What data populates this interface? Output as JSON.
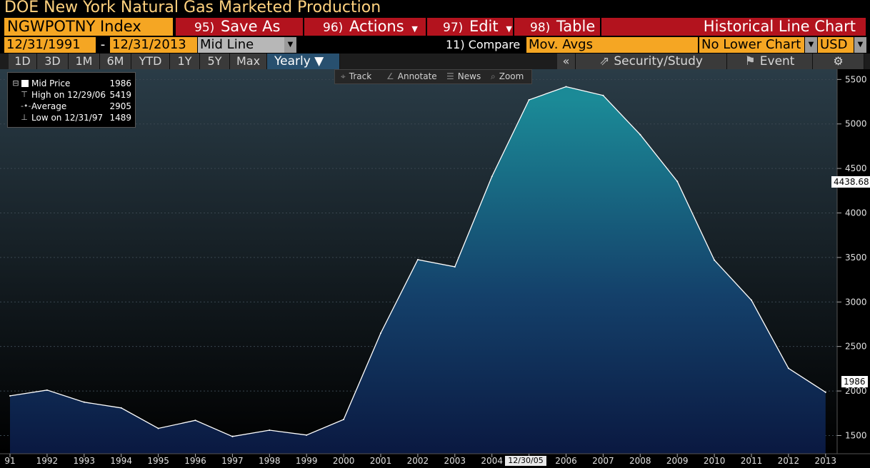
{
  "window": {
    "title": "DOE New York Natural Gas Marketed Production"
  },
  "toolbar": {
    "ticker": "NGWPOTNY Index",
    "buttons": [
      {
        "num": "95)",
        "label": "Save As"
      },
      {
        "num": "96)",
        "label": "Actions",
        "dropdown": true
      },
      {
        "num": "97)",
        "label": "Edit",
        "dropdown": true
      },
      {
        "num": "98)",
        "label": "Table"
      }
    ],
    "view_title": "Historical Line Chart"
  },
  "range": {
    "start": "12/31/1991",
    "separator": "-",
    "end": "12/31/2013",
    "price_field": "Mid Line",
    "compare": "11) Compare",
    "mov_avgs": "Mov. Avgs",
    "lower_chart": "No Lower Chart",
    "currency": "USD"
  },
  "periods": [
    "1D",
    "3D",
    "1M",
    "6M",
    "YTD",
    "1Y",
    "5Y",
    "Max"
  ],
  "frequency": "Yearly ▼",
  "collapse": "«",
  "security_study": "Security/Study",
  "event": "Event",
  "settings_icon": "gear-icon",
  "chart_tools": [
    "Track",
    "Annotate",
    "News",
    "Zoom"
  ],
  "legend": [
    {
      "label": "Mid Price",
      "value": "1986"
    },
    {
      "label": "High on 12/29/06",
      "value": "5419"
    },
    {
      "label": "Average",
      "value": "2905"
    },
    {
      "label": "Low on 12/31/97",
      "value": "1489"
    }
  ],
  "last_price_tag": "1986",
  "crosshair_tag": "4438.68",
  "date_flag": "12/30/05",
  "colors": {
    "area_top": "#1b8a97",
    "area_bottom": "#0a1840",
    "line": "#ffffff",
    "toolbar_red": "#b3131e",
    "field_orange": "#f5a623"
  },
  "chart_data": {
    "type": "area",
    "title": "DOE New York Natural Gas Marketed Production",
    "series": [
      {
        "name": "Mid Price",
        "x": [
          1991,
          1992,
          1993,
          1994,
          1995,
          1996,
          1997,
          1998,
          1999,
          2000,
          2001,
          2002,
          2003,
          2004,
          2005,
          2006,
          2007,
          2008,
          2009,
          2010,
          2011,
          2012,
          2013
        ],
        "values": [
          1945,
          2010,
          1875,
          1810,
          1580,
          1670,
          1489,
          1560,
          1505,
          1680,
          2650,
          3475,
          3395,
          4410,
          5270,
          5419,
          5320,
          4880,
          4355,
          3470,
          3020,
          2255,
          1986
        ]
      }
    ],
    "x_ticks": [
      "91",
      "1992",
      "1993",
      "1994",
      "1995",
      "1996",
      "1997",
      "1998",
      "1999",
      "2000",
      "2001",
      "2002",
      "2003",
      "2004",
      "2005",
      "2006",
      "2007",
      "2008",
      "2009",
      "2010",
      "2011",
      "2012",
      "2013"
    ],
    "y_ticks": [
      1500,
      2000,
      2500,
      3000,
      3500,
      4000,
      4500,
      5000,
      5500
    ],
    "ylim": [
      1135,
      5615
    ],
    "xlim": [
      1991,
      2014
    ],
    "grid": true,
    "legend": "top-left"
  }
}
